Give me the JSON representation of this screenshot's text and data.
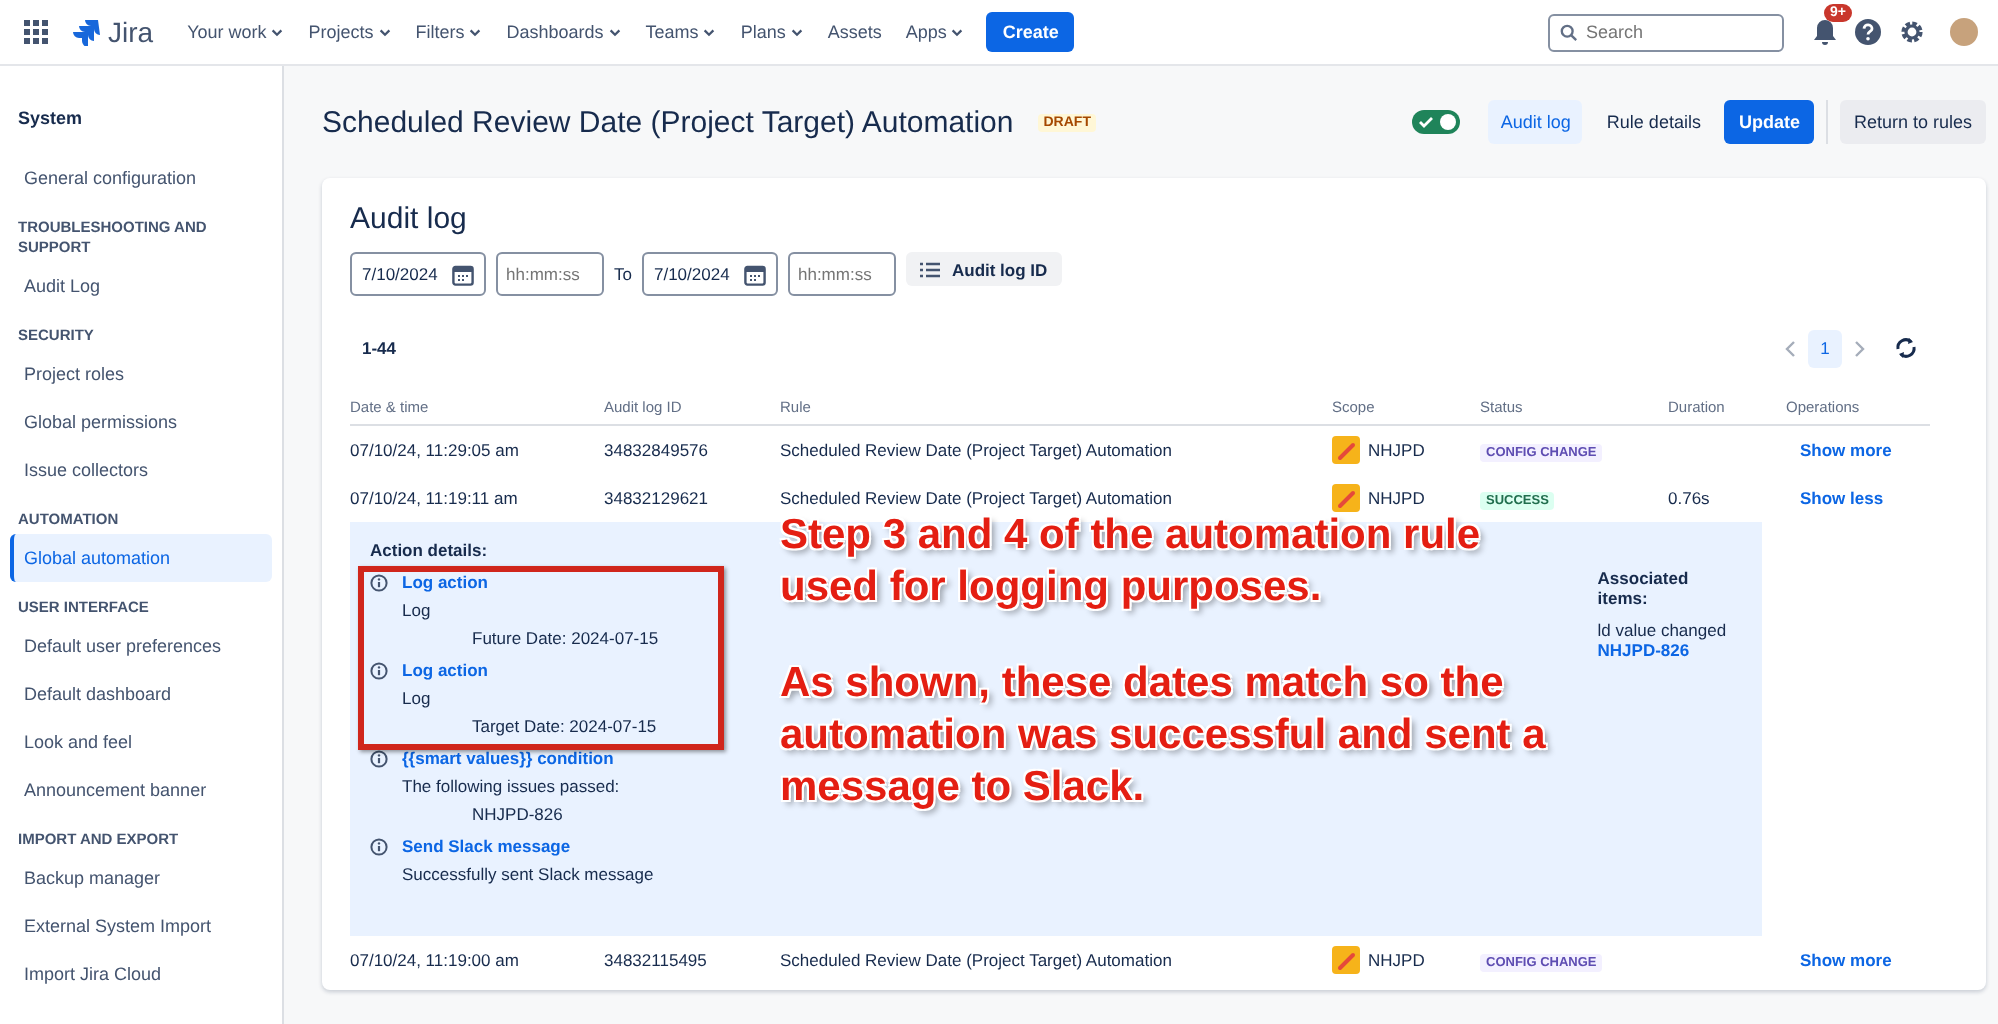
{
  "topnav": {
    "product": "Jira",
    "items": [
      {
        "label": "Your work",
        "dropdown": true
      },
      {
        "label": "Projects",
        "dropdown": true
      },
      {
        "label": "Filters",
        "dropdown": true
      },
      {
        "label": "Dashboards",
        "dropdown": true
      },
      {
        "label": "Teams",
        "dropdown": true
      },
      {
        "label": "Plans",
        "dropdown": true
      },
      {
        "label": "Assets",
        "dropdown": false
      },
      {
        "label": "Apps",
        "dropdown": true
      }
    ],
    "create": "Create",
    "search": {
      "placeholder": "Search"
    },
    "notification_badge": "9+"
  },
  "sidebar": {
    "title": "System",
    "sections": [
      {
        "items": [
          {
            "label": "General configuration",
            "selected": false
          }
        ]
      },
      {
        "heading": "TROUBLESHOOTING AND SUPPORT",
        "items": [
          {
            "label": "Audit Log",
            "selected": false
          }
        ]
      },
      {
        "heading": "SECURITY",
        "items": [
          {
            "label": "Project roles",
            "selected": false
          },
          {
            "label": "Global permissions",
            "selected": false
          },
          {
            "label": "Issue collectors",
            "selected": false
          }
        ]
      },
      {
        "heading": "AUTOMATION",
        "items": [
          {
            "label": "Global automation",
            "selected": true
          }
        ]
      },
      {
        "heading": "USER INTERFACE",
        "items": [
          {
            "label": "Default user preferences",
            "selected": false
          },
          {
            "label": "Default dashboard",
            "selected": false
          },
          {
            "label": "Look and feel",
            "selected": false
          },
          {
            "label": "Announcement banner",
            "selected": false
          }
        ]
      },
      {
        "heading": "IMPORT AND EXPORT",
        "items": [
          {
            "label": "Backup manager",
            "selected": false
          },
          {
            "label": "External System Import",
            "selected": false
          },
          {
            "label": "Import Jira Cloud",
            "selected": false
          }
        ]
      }
    ]
  },
  "header": {
    "title": "Scheduled Review Date (Project Target) Automation",
    "badge": "DRAFT",
    "rule_enabled": true,
    "tabs": [
      {
        "label": "Audit log",
        "selected": true
      },
      {
        "label": "Rule details",
        "selected": false
      }
    ],
    "update": "Update",
    "return": "Return to rules"
  },
  "audit": {
    "title": "Audit log",
    "from_date": "7/10/2024",
    "from_time": {
      "placeholder": "hh:mm:ss"
    },
    "to_label": "To",
    "to_date": "7/10/2024",
    "to_time": {
      "placeholder": "hh:mm:ss"
    },
    "id_button": "Audit log ID",
    "range": "1-44",
    "page": "1",
    "columns": [
      "Date & time",
      "Audit log ID",
      "Rule",
      "Scope",
      "Status",
      "Duration",
      "Operations"
    ],
    "rows": [
      {
        "date": "07/10/24, 11:29:05 am",
        "id": "34832849576",
        "rule": "Scheduled Review Date (Project Target) Automation",
        "scope": "NHJPD",
        "status": {
          "label": "CONFIG CHANGE",
          "kind": "config"
        },
        "operation": "Show more",
        "expanded": false
      },
      {
        "date": "07/10/24, 11:19:11 am",
        "id": "34832129621",
        "rule": "Scheduled Review Date (Project Target) Automation",
        "scope": "NHJPD",
        "status": {
          "label": "SUCCESS",
          "kind": "success"
        },
        "duration": "0.76s",
        "operation": "Show less",
        "expanded": true,
        "details": {
          "title": "Action details:",
          "actions": [
            {
              "name": "Log action",
              "lines": [
                "Log"
              ],
              "sub": "Future Date: 2024-07-15"
            },
            {
              "name": "Log action",
              "lines": [
                "Log"
              ],
              "sub": "Target Date: 2024-07-15"
            },
            {
              "name": "{{smart values}} condition",
              "lines": [
                "The following issues passed:"
              ],
              "sub": "NHJPD-826"
            },
            {
              "name": "Send Slack message",
              "lines": [
                "Successfully sent Slack message"
              ]
            }
          ],
          "associated": {
            "title": "Associated items:",
            "note": "ld value changed",
            "link": "NHJPD-826"
          }
        }
      },
      {
        "date": "07/10/24, 11:19:00 am",
        "id": "34832115495",
        "rule": "Scheduled Review Date (Project Target) Automation",
        "scope": "NHJPD",
        "status": {
          "label": "CONFIG CHANGE",
          "kind": "config"
        },
        "operation": "Show more",
        "expanded": false
      }
    ]
  },
  "annotation": {
    "paragraphs": [
      "Step 3 and 4 of the automation rule used for logging purposes.",
      "As shown, these dates match so the automation was successful and sent a message to Slack."
    ]
  }
}
